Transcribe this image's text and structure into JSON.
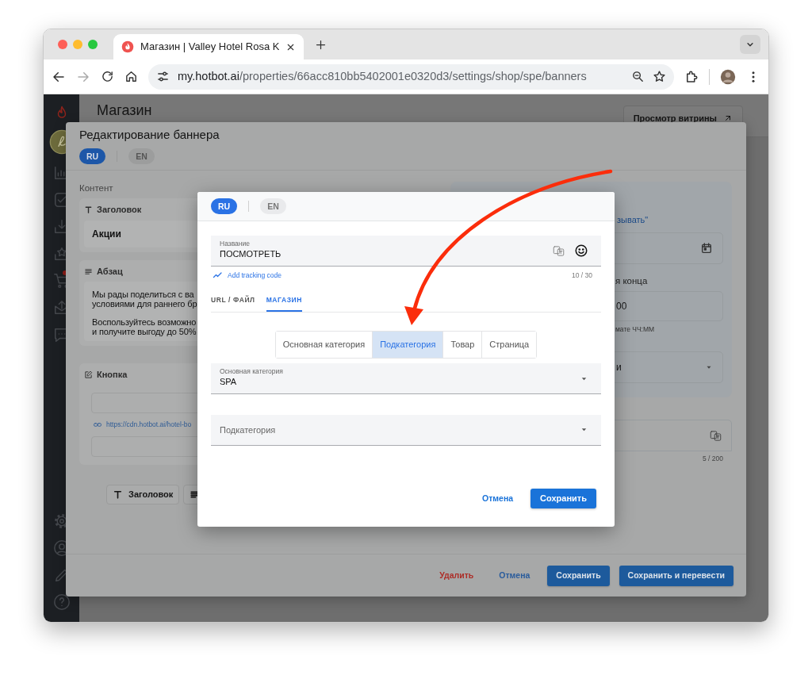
{
  "browser": {
    "tab_title": "Магазин | Valley Hotel Rosa K",
    "url": "my.hotbot.ai/properties/66acc810bb5402001e0320d3/settings/shop/spe/banners"
  },
  "page": {
    "title": "Магазин",
    "storefront_button": "Просмотр витрины"
  },
  "dialog": {
    "title": "Редактирование баннера",
    "languages": [
      {
        "label": "RU",
        "selected": true
      },
      {
        "label": "EN",
        "selected": false
      }
    ],
    "content_label": "Контент",
    "blocks": [
      {
        "kind": "heading",
        "label": "Заголовок",
        "value": "Акции"
      },
      {
        "kind": "paragraph",
        "label": "Абзац",
        "paragraphs": [
          [
            "Мы рады поделиться с ва",
            "условиями для раннего бр"
          ],
          [
            "Воспользуйтесь возможно",
            "и получите выгоду до 50%"
          ]
        ]
      },
      {
        "kind": "button",
        "label": "Кнопка",
        "link": "https://cdn.hotbot.ai/hotel-bo"
      }
    ],
    "add_buttons": [
      {
        "kind": "heading",
        "label": "Заголовок"
      },
      {
        "kind": "paragraph"
      }
    ],
    "right_panel": {
      "link_text": "зывать\"",
      "end_time_label": "я конца",
      "end_time_value": "00",
      "end_time_hint": "мате ЧЧ:ММ",
      "select_value": "и"
    },
    "text_counter": "5 / 200",
    "footer": {
      "delete": "Удалить",
      "cancel": "Отмена",
      "save": "Сохранить",
      "save_translate": "Сохранить и перевести"
    }
  },
  "modal": {
    "languages": [
      {
        "label": "RU",
        "selected": true
      },
      {
        "label": "EN",
        "selected": false
      }
    ],
    "name_field": {
      "label": "Название",
      "value": "ПОСМОТРЕТЬ",
      "counter": "10 / 30"
    },
    "tracking_link": "Add tracking code",
    "tabs": [
      {
        "label": "URL / ФАЙЛ",
        "selected": false
      },
      {
        "label": "МАГАЗИН",
        "selected": true
      }
    ],
    "link_types": [
      {
        "label": "Основная категория",
        "selected": false
      },
      {
        "label": "Подкатегория",
        "selected": true
      },
      {
        "label": "Товар",
        "selected": false
      },
      {
        "label": "Страница",
        "selected": false
      }
    ],
    "main_category": {
      "label": "Основная категория",
      "value": "SPA"
    },
    "subcategory": {
      "placeholder": "Подкатегория"
    },
    "cancel": "Отмена",
    "save": "Сохранить"
  }
}
